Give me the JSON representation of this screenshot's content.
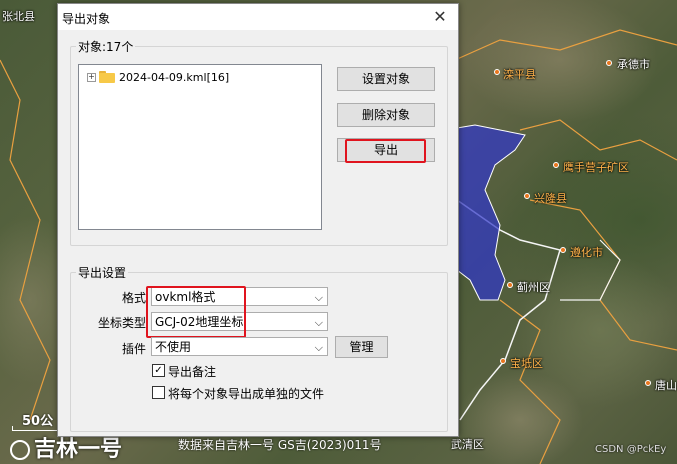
{
  "map": {
    "labels": [
      {
        "text": "张北县",
        "color": "white"
      },
      {
        "text": "承德市",
        "color": "white"
      },
      {
        "text": "滦平县",
        "color": "orange"
      },
      {
        "text": "鹰手营子矿区",
        "color": "orange"
      },
      {
        "text": "兴隆县",
        "color": "orange"
      },
      {
        "text": "遵化市",
        "color": "orange"
      },
      {
        "text": "蓟州区",
        "color": "white"
      },
      {
        "text": "宝坻区",
        "color": "orange"
      },
      {
        "text": "唐山",
        "color": "white"
      },
      {
        "text": "武清区",
        "color": "white"
      }
    ],
    "brand": "吉林一号",
    "scale": "50公",
    "copyright": "数据来自吉林一号 GS吉(2023)011号",
    "watermark": "CSDN @PckEy"
  },
  "dialog": {
    "title": "导出对象",
    "close_icon": "close-icon",
    "objects_group_label": "对象:17个",
    "tree": {
      "expander": "+",
      "item_label": "2024-04-09.kml[16]"
    },
    "buttons": {
      "set_objects": "设置对象",
      "delete_objects": "删除对象",
      "export": "导出",
      "manage": "管理"
    },
    "settings_group_label": "导出设置",
    "format": {
      "label": "格式",
      "value": "ovkml格式"
    },
    "coord_type": {
      "label": "坐标类型",
      "value": "GCJ-02地理坐标"
    },
    "plugin": {
      "label": "插件",
      "value": "不使用"
    },
    "checkboxes": {
      "export_notes": {
        "label": "导出备注",
        "checked": true
      },
      "separate_files": {
        "label": "将每个对象导出成单独的文件",
        "checked": false
      }
    }
  },
  "colors": {
    "highlight": "#e0141e",
    "region_fill": "#3038c8",
    "region_border": "#ffffff"
  }
}
